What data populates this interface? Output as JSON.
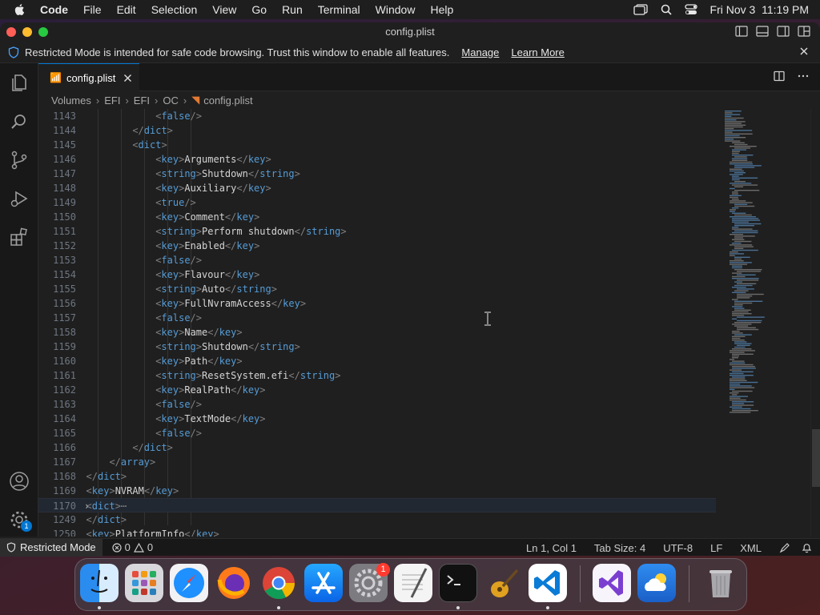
{
  "menubar": {
    "app": "Code",
    "items": [
      "File",
      "Edit",
      "Selection",
      "View",
      "Go",
      "Run",
      "Terminal",
      "Window",
      "Help"
    ],
    "clock": "Fri Nov 3  11:19 PM"
  },
  "window": {
    "title": "config.plist"
  },
  "banner": {
    "message": "Restricted Mode is intended for safe code browsing. Trust this window to enable all features.",
    "manage": "Manage",
    "learn_more": "Learn More"
  },
  "tab": {
    "label": "config.plist"
  },
  "breadcrumbs": [
    "Volumes",
    "EFI",
    "EFI",
    "OC",
    "config.plist"
  ],
  "editor": {
    "lines": [
      {
        "n": "1143",
        "indent": 6,
        "tag": "false/"
      },
      {
        "n": "1144",
        "indent": 5,
        "tag": "/dict"
      },
      {
        "n": "1145",
        "indent": 5,
        "tag": "dict"
      },
      {
        "n": "1146",
        "indent": 6,
        "tag": "key",
        "text": "Arguments"
      },
      {
        "n": "1147",
        "indent": 6,
        "tag": "string",
        "text": "Shutdown"
      },
      {
        "n": "1148",
        "indent": 6,
        "tag": "key",
        "text": "Auxiliary"
      },
      {
        "n": "1149",
        "indent": 6,
        "tag": "true/"
      },
      {
        "n": "1150",
        "indent": 6,
        "tag": "key",
        "text": "Comment"
      },
      {
        "n": "1151",
        "indent": 6,
        "tag": "string",
        "text": "Perform shutdown"
      },
      {
        "n": "1152",
        "indent": 6,
        "tag": "key",
        "text": "Enabled"
      },
      {
        "n": "1153",
        "indent": 6,
        "tag": "false/"
      },
      {
        "n": "1154",
        "indent": 6,
        "tag": "key",
        "text": "Flavour"
      },
      {
        "n": "1155",
        "indent": 6,
        "tag": "string",
        "text": "Auto"
      },
      {
        "n": "1156",
        "indent": 6,
        "tag": "key",
        "text": "FullNvramAccess"
      },
      {
        "n": "1157",
        "indent": 6,
        "tag": "false/"
      },
      {
        "n": "1158",
        "indent": 6,
        "tag": "key",
        "text": "Name"
      },
      {
        "n": "1159",
        "indent": 6,
        "tag": "string",
        "text": "Shutdown"
      },
      {
        "n": "1160",
        "indent": 6,
        "tag": "key",
        "text": "Path"
      },
      {
        "n": "1161",
        "indent": 6,
        "tag": "string",
        "text": "ResetSystem.efi"
      },
      {
        "n": "1162",
        "indent": 6,
        "tag": "key",
        "text": "RealPath"
      },
      {
        "n": "1163",
        "indent": 6,
        "tag": "false/"
      },
      {
        "n": "1164",
        "indent": 6,
        "tag": "key",
        "text": "TextMode"
      },
      {
        "n": "1165",
        "indent": 6,
        "tag": "false/"
      },
      {
        "n": "1166",
        "indent": 5,
        "tag": "/dict"
      },
      {
        "n": "1167",
        "indent": 4,
        "tag": "/array"
      },
      {
        "n": "1168",
        "indent": 3,
        "tag": "/dict"
      },
      {
        "n": "1169",
        "indent": 3,
        "tag": "key",
        "text": "NVRAM"
      },
      {
        "n": "1170",
        "indent": 3,
        "tag": "dict",
        "folded": true,
        "current": true,
        "suffix": "⋯"
      },
      {
        "n": "1249",
        "indent": 3,
        "tag": "/dict"
      },
      {
        "n": "1250",
        "indent": 3,
        "tag": "key",
        "text": "PlatformInfo"
      }
    ]
  },
  "status": {
    "restricted": "Restricted Mode",
    "errors": "0",
    "warnings": "0",
    "position": "Ln 1, Col 1",
    "tab_size": "Tab Size: 4",
    "encoding": "UTF-8",
    "eol": "LF",
    "language": "XML"
  },
  "accounts_badge": "1",
  "dock": {
    "settings_badge": "1"
  }
}
